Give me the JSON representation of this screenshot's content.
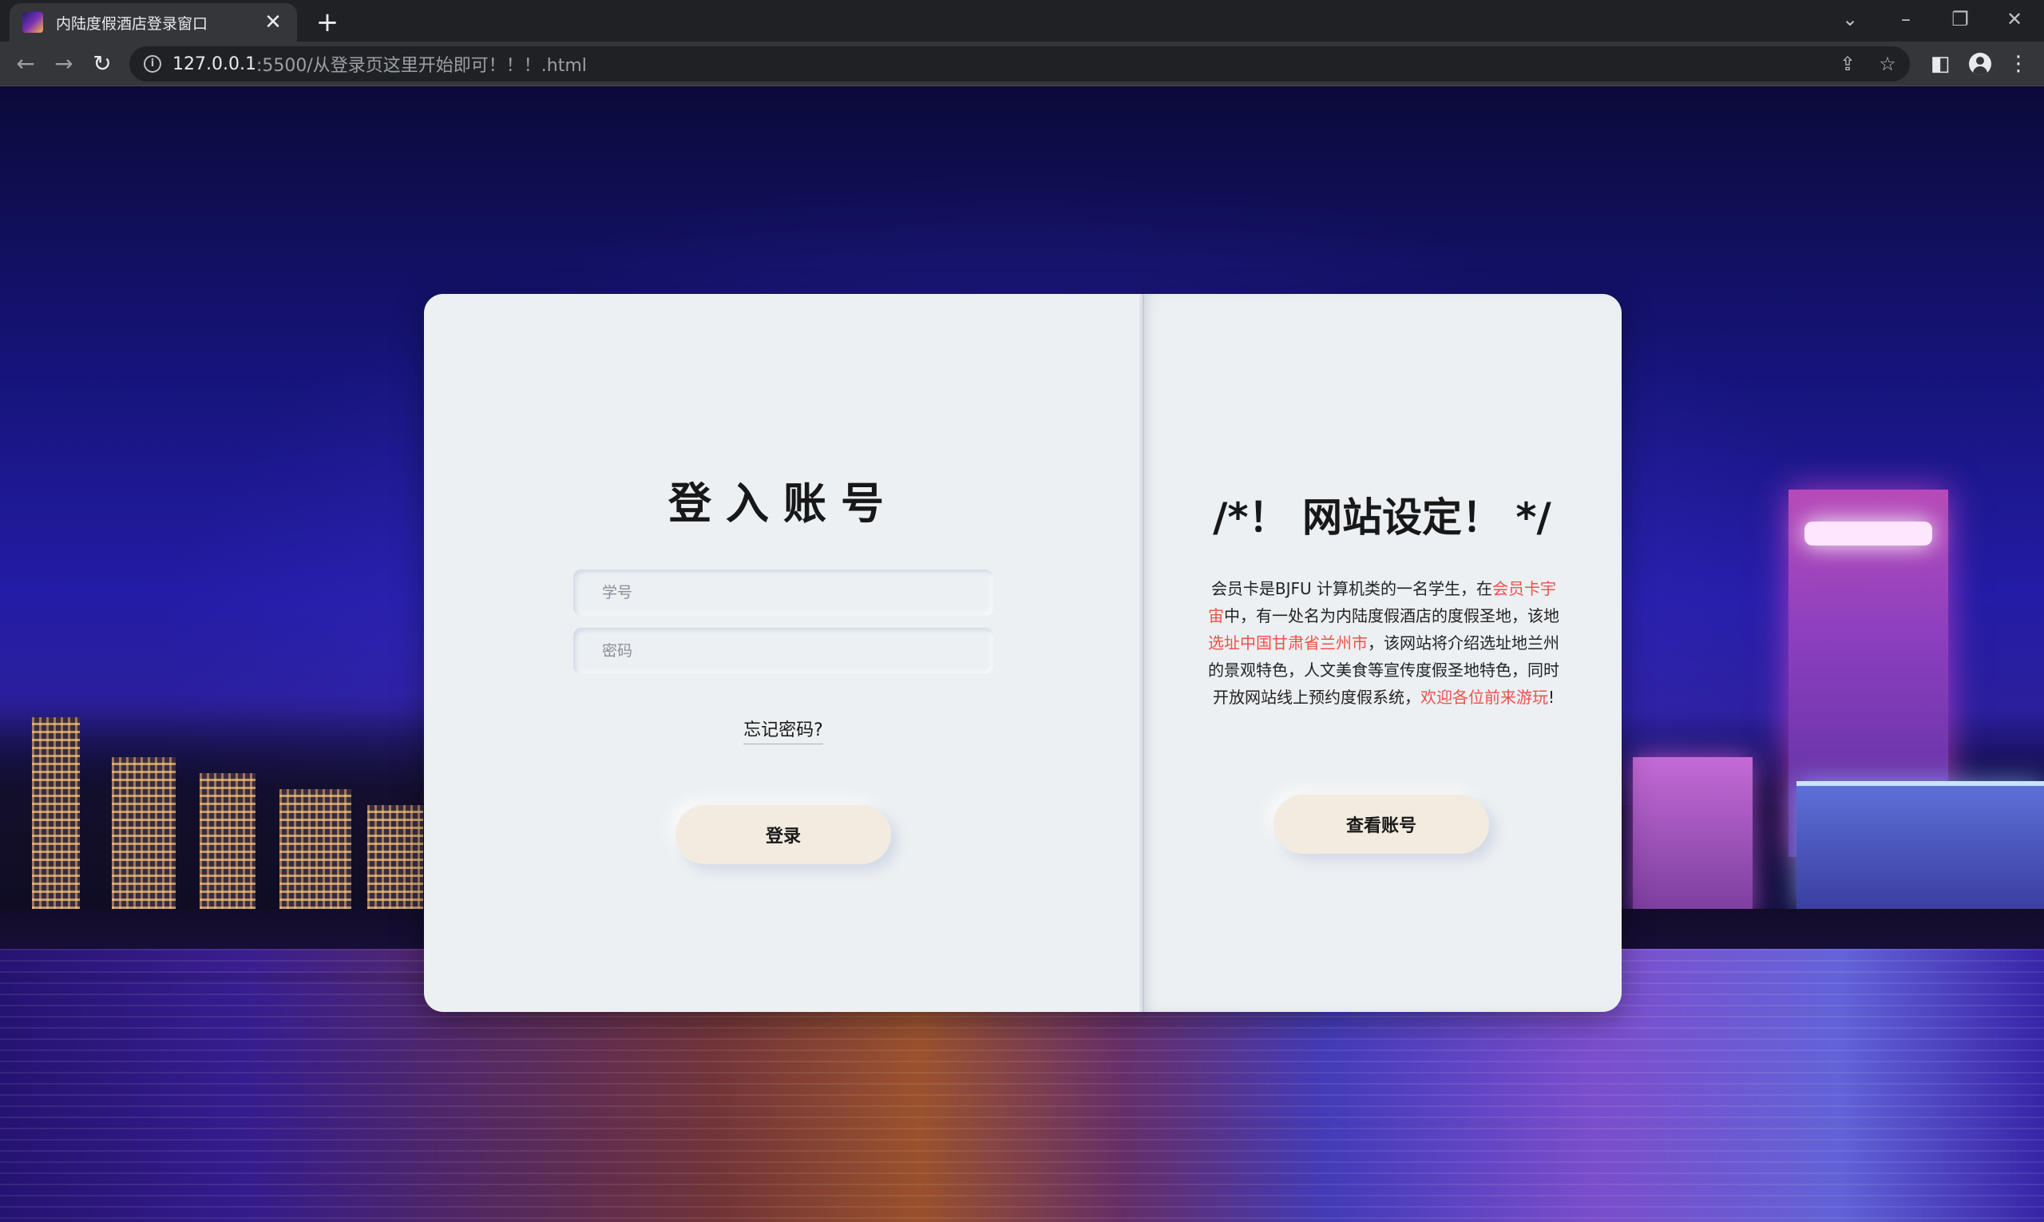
{
  "browser": {
    "tab_title": "内陆度假酒店登录窗口",
    "tab_close": "✕",
    "new_tab": "+",
    "url_host": "127.0.0.1",
    "url_rest": ":5500/从登录页这里开始即可！！！.html"
  },
  "login": {
    "title": "登入账号",
    "student_id_placeholder": "学号",
    "password_placeholder": "密码",
    "forgot_password": "忘记密码?",
    "login_button": "登录"
  },
  "info": {
    "title": "/*！ 网站设定！ */",
    "text_1": "会员卡是BJFU 计算机类的一名学生，在",
    "text_hl_1": "会员卡宇宙",
    "text_2": "中，有一处名为内陆度假酒店的度假圣地，该地",
    "text_hl_2": "选址中国甘肃省兰州市",
    "text_3": "，该网站将介绍选址地兰州的景观特色，人文美食等宣传度假圣地特色，同时开放网站线上预约度假系统，",
    "text_hl_3": "欢迎各位前来游玩",
    "text_4": "!",
    "highlight_color": "#f0504a",
    "view_account_button": "查看账号"
  }
}
